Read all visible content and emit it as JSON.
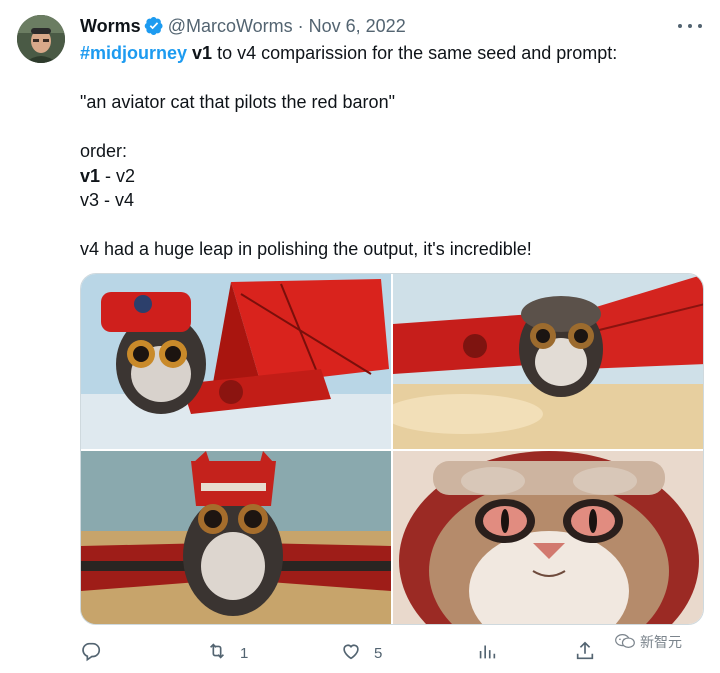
{
  "tweet": {
    "author_name": "Worms",
    "author_handle": "@MarcoWorms",
    "separator": "·",
    "date": "Nov 6, 2022",
    "line1": {
      "hashtag": "#midjourney",
      "bold": "v1",
      "rest": " to v4 comparission for the same seed and prompt:"
    },
    "line2": "\"an aviator cat that pilots the red baron\"",
    "line3": "order:",
    "line4": {
      "bold": "v1",
      "rest": " - v2"
    },
    "line5": "v3 - v4",
    "line6": "v4 had a huge leap in polishing the output, it's incredible!"
  },
  "actions": {
    "retweet_count": "1",
    "like_count": "5"
  },
  "watermark": {
    "text": "新智元"
  },
  "icons": [
    "verified-badge-icon",
    "more-options-icon",
    "reply-icon",
    "retweet-icon",
    "like-icon",
    "views-icon",
    "share-icon",
    "wechat-icon"
  ],
  "colors": {
    "accent": "#1d9bf0",
    "secondary_text": "#536471",
    "border": "#cfd9de"
  }
}
